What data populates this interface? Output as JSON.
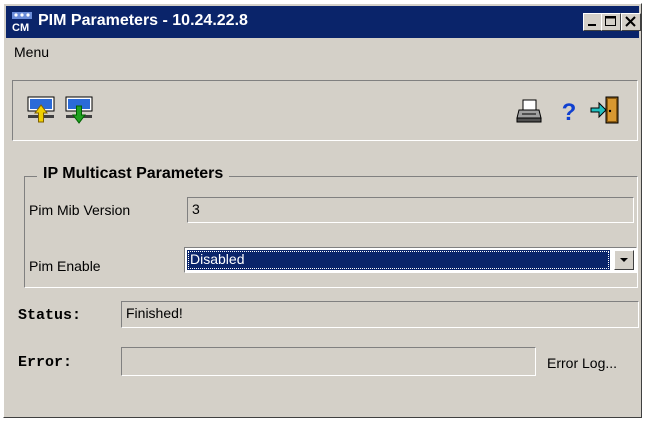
{
  "window": {
    "title": "PIM Parameters - 10.24.22.8",
    "app_icon": "cm-app-icon"
  },
  "menu": {
    "label": "Menu"
  },
  "toolbar": {
    "tools_left": [
      "upload-icon",
      "download-icon"
    ],
    "tools_right": [
      "print-icon",
      "help-icon",
      "exit-icon"
    ]
  },
  "group": {
    "title": "IP Multicast Parameters",
    "pim_mib_version_label": "Pim Mib Version",
    "pim_mib_version_value": "3",
    "pim_enable_label": "Pim Enable",
    "pim_enable_value": "Disabled"
  },
  "status": {
    "label": "Status:",
    "value": "Finished!"
  },
  "error": {
    "label": "Error:",
    "value": "",
    "log_label": "Error Log..."
  },
  "colors": {
    "titlebar": "#0a246a",
    "face": "#d4d0c8",
    "selection": "#0a246a"
  }
}
